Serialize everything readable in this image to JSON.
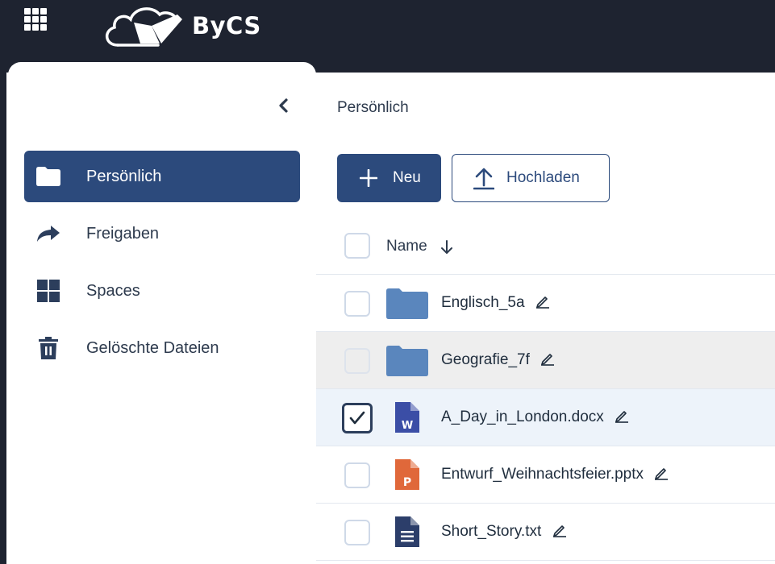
{
  "header": {
    "brand": "ByCS",
    "app_grid_icon": "app-grid-icon",
    "logo_icon": "cloud-folder-icon"
  },
  "sidebar": {
    "collapse_icon": "chevron-left-icon",
    "items": [
      {
        "label": "Persönlich",
        "icon": "folder-icon",
        "active": true
      },
      {
        "label": "Freigaben",
        "icon": "share-arrow-icon",
        "active": false
      },
      {
        "label": "Spaces",
        "icon": "spaces-grid-icon",
        "active": false
      },
      {
        "label": "Gelöschte Dateien",
        "icon": "trash-icon",
        "active": false
      }
    ]
  },
  "main": {
    "breadcrumb": "Persönlich",
    "new_button": "Neu",
    "upload_button": "Hochladen",
    "table": {
      "column_name": "Name",
      "sort": "descending",
      "rows": [
        {
          "name": "Englisch_5a",
          "type": "folder",
          "checked": false,
          "state": "normal"
        },
        {
          "name": "Geografie_7f",
          "type": "folder",
          "checked": false,
          "state": "hover"
        },
        {
          "name": "A_Day_in_London.docx",
          "type": "docx",
          "checked": true,
          "state": "selected"
        },
        {
          "name": "Entwurf_Weihnachtsfeier.pptx",
          "type": "pptx",
          "checked": false,
          "state": "normal"
        },
        {
          "name": "Short_Story.txt",
          "type": "txt",
          "checked": false,
          "state": "normal"
        }
      ]
    }
  },
  "colors": {
    "topbar": "#1e2330",
    "primary": "#2c4a7c",
    "folder": "#5a86bd",
    "word": "#3b4ea6",
    "powerpoint": "#e0683a",
    "text_file": "#2c3e6a"
  }
}
